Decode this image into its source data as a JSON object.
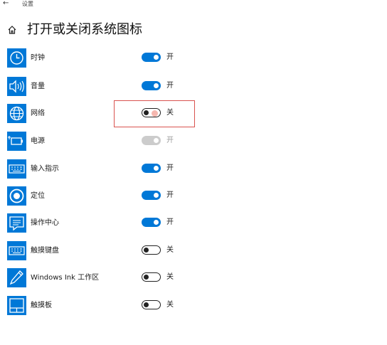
{
  "window": {
    "title": "设置",
    "back_icon": "back-arrow-icon"
  },
  "header": {
    "home_icon": "home-icon",
    "title": "打开或关闭系统图标"
  },
  "colors": {
    "accent": "#0078d7",
    "toggle_off": "#222222",
    "toggle_disabled": "#cccccc",
    "highlight": "#d9534f"
  },
  "items": [
    {
      "icon": "clock-icon",
      "label": "时钟",
      "state": "on",
      "state_label": "开"
    },
    {
      "icon": "volume-icon",
      "label": "音量",
      "state": "on",
      "state_label": "开"
    },
    {
      "icon": "network-globe-icon",
      "label": "网络",
      "state": "off",
      "state_label": "关"
    },
    {
      "icon": "power-battery-icon",
      "label": "电源",
      "state": "disabled",
      "state_label": "开"
    },
    {
      "icon": "keyboard-input-icon",
      "label": "输入指示",
      "state": "on",
      "state_label": "开"
    },
    {
      "icon": "location-icon",
      "label": "定位",
      "state": "on",
      "state_label": "开"
    },
    {
      "icon": "action-center-icon",
      "label": "操作中心",
      "state": "on",
      "state_label": "开"
    },
    {
      "icon": "touch-keyboard-icon",
      "label": "触摸键盘",
      "state": "off",
      "state_label": "关"
    },
    {
      "icon": "windows-ink-pen-icon",
      "label": "Windows Ink 工作区",
      "state": "off",
      "state_label": "关"
    },
    {
      "icon": "touchpad-icon",
      "label": "触摸板",
      "state": "off",
      "state_label": "关"
    }
  ]
}
